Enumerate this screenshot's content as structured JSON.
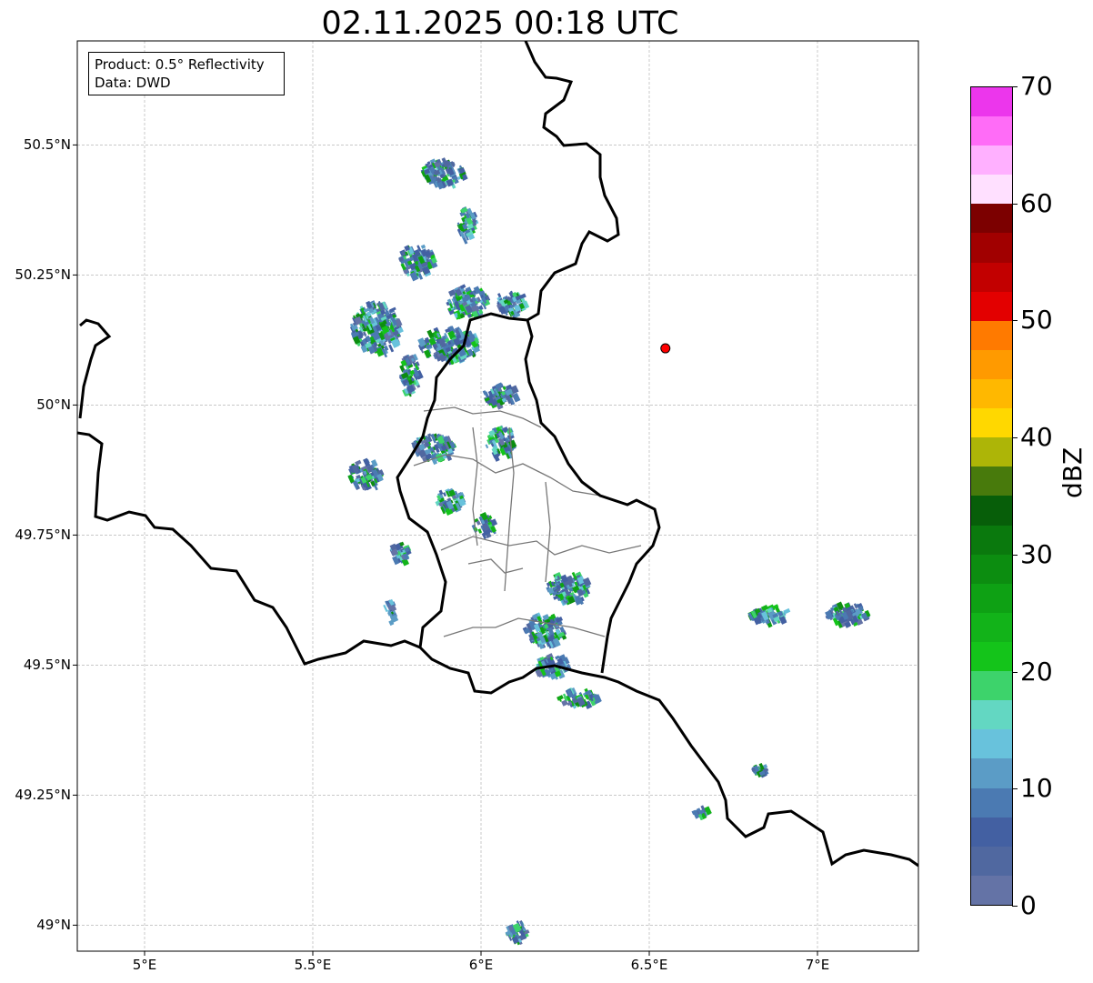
{
  "title": "02.11.2025 00:18 UTC",
  "info": {
    "product": "Product: 0.5° Reflectivity",
    "source": "Data: DWD"
  },
  "map": {
    "lon_range": [
      4.8,
      7.3
    ],
    "lat_range": [
      48.95,
      50.7
    ],
    "lat_ticks": [
      {
        "value": 50.5,
        "label": "50.5°N"
      },
      {
        "value": 50.25,
        "label": "50.25°N"
      },
      {
        "value": 50.0,
        "label": "50°N"
      },
      {
        "value": 49.75,
        "label": "49.75°N"
      },
      {
        "value": 49.5,
        "label": "49.5°N"
      },
      {
        "value": 49.25,
        "label": "49.25°N"
      },
      {
        "value": 49.0,
        "label": "49°N"
      }
    ],
    "lon_ticks": [
      {
        "value": 5.0,
        "label": "5°E"
      },
      {
        "value": 5.5,
        "label": "5.5°E"
      },
      {
        "value": 6.0,
        "label": "6°E"
      },
      {
        "value": 6.5,
        "label": "6.5°E"
      },
      {
        "value": 7.0,
        "label": "7°E"
      }
    ],
    "radar_site": {
      "lon": 6.548,
      "lat": 50.109,
      "color": "#ff0000"
    },
    "echo_regions": [
      {
        "lon": 5.88,
        "lat": 50.45,
        "w": 0.12,
        "h": 0.05
      },
      {
        "lon": 5.95,
        "lat": 50.35,
        "w": 0.05,
        "h": 0.06
      },
      {
        "lon": 5.8,
        "lat": 50.28,
        "w": 0.1,
        "h": 0.06
      },
      {
        "lon": 5.95,
        "lat": 50.2,
        "w": 0.12,
        "h": 0.06
      },
      {
        "lon": 5.68,
        "lat": 50.15,
        "w": 0.14,
        "h": 0.1
      },
      {
        "lon": 5.9,
        "lat": 50.12,
        "w": 0.18,
        "h": 0.06
      },
      {
        "lon": 6.08,
        "lat": 50.2,
        "w": 0.08,
        "h": 0.05
      },
      {
        "lon": 5.78,
        "lat": 50.06,
        "w": 0.05,
        "h": 0.08
      },
      {
        "lon": 6.05,
        "lat": 50.02,
        "w": 0.1,
        "h": 0.04
      },
      {
        "lon": 5.85,
        "lat": 49.92,
        "w": 0.12,
        "h": 0.05
      },
      {
        "lon": 6.05,
        "lat": 49.93,
        "w": 0.08,
        "h": 0.06
      },
      {
        "lon": 5.65,
        "lat": 49.87,
        "w": 0.1,
        "h": 0.05
      },
      {
        "lon": 5.9,
        "lat": 49.82,
        "w": 0.08,
        "h": 0.04
      },
      {
        "lon": 6.0,
        "lat": 49.77,
        "w": 0.06,
        "h": 0.04
      },
      {
        "lon": 5.75,
        "lat": 49.72,
        "w": 0.05,
        "h": 0.04
      },
      {
        "lon": 6.25,
        "lat": 49.65,
        "w": 0.12,
        "h": 0.06
      },
      {
        "lon": 6.18,
        "lat": 49.57,
        "w": 0.12,
        "h": 0.06
      },
      {
        "lon": 6.2,
        "lat": 49.5,
        "w": 0.1,
        "h": 0.04
      },
      {
        "lon": 6.28,
        "lat": 49.44,
        "w": 0.12,
        "h": 0.03
      },
      {
        "lon": 6.85,
        "lat": 49.6,
        "w": 0.12,
        "h": 0.03
      },
      {
        "lon": 7.08,
        "lat": 49.6,
        "w": 0.12,
        "h": 0.04
      },
      {
        "lon": 6.82,
        "lat": 49.3,
        "w": 0.04,
        "h": 0.02
      },
      {
        "lon": 6.65,
        "lat": 49.22,
        "w": 0.05,
        "h": 0.02
      },
      {
        "lon": 6.1,
        "lat": 48.99,
        "w": 0.06,
        "h": 0.04
      },
      {
        "lon": 5.72,
        "lat": 49.6,
        "w": 0.03,
        "h": 0.05
      }
    ]
  },
  "colorbar": {
    "label": "dBZ",
    "min": 0,
    "max": 70,
    "ticks": [
      {
        "value": 0,
        "label": "0"
      },
      {
        "value": 10,
        "label": "10"
      },
      {
        "value": 20,
        "label": "20"
      },
      {
        "value": 30,
        "label": "30"
      },
      {
        "value": 40,
        "label": "40"
      },
      {
        "value": 50,
        "label": "50"
      },
      {
        "value": 60,
        "label": "60"
      },
      {
        "value": 70,
        "label": "70"
      }
    ],
    "colors": [
      "#6473a6",
      "#5068a0",
      "#4360a2",
      "#4b7ab2",
      "#5b9cc6",
      "#68c2dc",
      "#63d7c2",
      "#3dd36b",
      "#14c41a",
      "#12b319",
      "#0ea114",
      "#0c8d10",
      "#0a790d",
      "#075e09",
      "#487a0c",
      "#adb507",
      "#ffd800",
      "#ffb800",
      "#ff9a00",
      "#ff7a00",
      "#e30000",
      "#c20000",
      "#a10000",
      "#7c0000",
      "#ffe0ff",
      "#ffb0ff",
      "#ff6cf7",
      "#ec36ec"
    ]
  }
}
